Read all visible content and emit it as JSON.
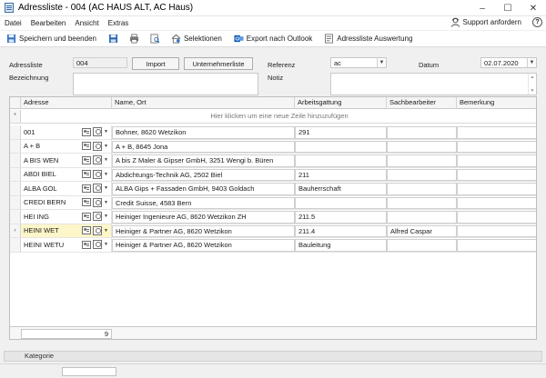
{
  "window": {
    "title": "Adressliste - 004 (AC HAUS ALT, AC Haus)",
    "controls": [
      "–",
      "☐",
      "✕"
    ]
  },
  "menu": {
    "items": [
      "Datei",
      "Bearbeiten",
      "Ansicht",
      "Extras"
    ],
    "support": "Support anfordern",
    "help": "?"
  },
  "toolbar": {
    "save_close": "Speichern und beenden",
    "selection": "Selektionen",
    "export": "Export nach Outlook",
    "report": "Adressliste Auswertung"
  },
  "form": {
    "adressliste_label": "Adressliste",
    "adressliste_value": "004",
    "import_label": "Import",
    "unternehmer_label": "Unternehmerliste",
    "referenz_label": "Referenz",
    "referenz_value": "ac",
    "datum_label": "Datum",
    "datum_value": "02.07.2020",
    "bezeichnung_label": "Bezeichnung",
    "notiz_label": "Notiz"
  },
  "grid": {
    "columns": [
      "Adresse",
      "Name, Ort",
      "Arbeitsgattung",
      "Sachbearbeiter",
      "Bemerkung"
    ],
    "new_row_hint": "Hier klicken um eine neue Zeile hinzuzufügen",
    "new_row_marker": "*",
    "active_marker": "›",
    "rows": [
      {
        "adresse": "001",
        "name_ort": "Bohner, 8620 Wetzikon",
        "arbeitsgattung": "291",
        "sachbearbeiter": "",
        "bemerkung": ""
      },
      {
        "adresse": "A + B",
        "name_ort": "A + B, 8645 Jona",
        "arbeitsgattung": "",
        "sachbearbeiter": "",
        "bemerkung": ""
      },
      {
        "adresse": "A BIS WEN",
        "name_ort": "A bis Z Maler & Gipser GmbH, 3251 Wengi b. Büren",
        "arbeitsgattung": "",
        "sachbearbeiter": "",
        "bemerkung": ""
      },
      {
        "adresse": "ABDI BIEL",
        "name_ort": "Abdichtungs-Technik AG, 2502 Biel",
        "arbeitsgattung": "211",
        "sachbearbeiter": "",
        "bemerkung": ""
      },
      {
        "adresse": "ALBA  GOL",
        "name_ort": "ALBA Gips + Fassaden GmbH, 9403 Goldach",
        "arbeitsgattung": "Bauherrschaft",
        "sachbearbeiter": "",
        "bemerkung": ""
      },
      {
        "adresse": "CREDI BERN",
        "name_ort": "Credit Suisse, 4583 Bern",
        "arbeitsgattung": "",
        "sachbearbeiter": "",
        "bemerkung": ""
      },
      {
        "adresse": "HEI ING",
        "name_ort": "Heiniger Ingenieure AG, 8620 Wetzikon ZH",
        "arbeitsgattung": "211.5",
        "sachbearbeiter": "",
        "bemerkung": ""
      },
      {
        "adresse": "HEINI WET",
        "name_ort": "Heiniger & Partner AG, 8620 Wetzikon",
        "arbeitsgattung": "211.4",
        "sachbearbeiter": "Alfred Caspar",
        "bemerkung": "",
        "active": true
      },
      {
        "adresse": "HEINI WETU",
        "name_ort": "Heiniger & Partner AG, 8620 Wetzikon",
        "arbeitsgattung": "Bauleitung",
        "sachbearbeiter": "",
        "bemerkung": ""
      }
    ],
    "row_count": "9"
  },
  "category_tab": "Kategorie"
}
